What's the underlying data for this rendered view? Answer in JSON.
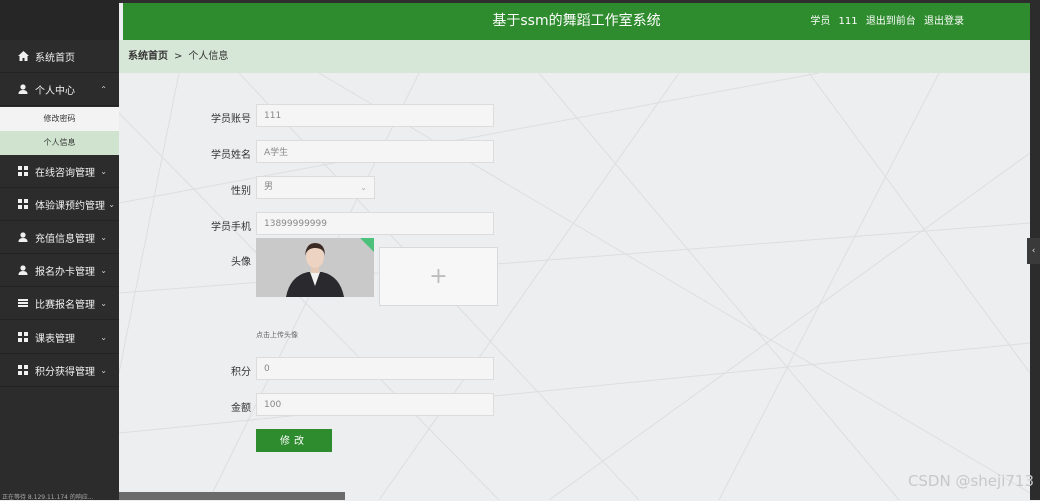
{
  "header": {
    "title": "基于ssm的舞蹈工作室系统",
    "user_role": "学员",
    "username": "111",
    "back_frontend": "退出到前台",
    "logout": "退出登录"
  },
  "breadcrumb": {
    "home": "系统首页",
    "separator": ">",
    "current": "个人信息"
  },
  "sidebar": {
    "items": [
      {
        "label": "系统首页",
        "icon": "home-icon"
      },
      {
        "label": "个人中心",
        "icon": "user-icon",
        "expanded": true
      },
      {
        "label": "在线咨询管理",
        "icon": "grid-icon"
      },
      {
        "label": "体验课预约管理",
        "icon": "grid-icon"
      },
      {
        "label": "充值信息管理",
        "icon": "user-icon"
      },
      {
        "label": "报名办卡管理",
        "icon": "user-icon"
      },
      {
        "label": "比赛报名管理",
        "icon": "list-icon"
      },
      {
        "label": "课表管理",
        "icon": "grid-icon"
      },
      {
        "label": "积分获得管理",
        "icon": "grid-icon"
      }
    ],
    "sub_items": [
      {
        "label": "修改密码",
        "active": false
      },
      {
        "label": "个人信息",
        "active": true
      }
    ]
  },
  "form": {
    "account_label": "学员账号",
    "account_value": "111",
    "name_label": "学员姓名",
    "name_value": "A学生",
    "gender_label": "性别",
    "gender_value": "男",
    "phone_label": "学员手机",
    "phone_value": "13899999999",
    "avatar_label": "头像",
    "upload_plus": "+",
    "upload_hint": "点击上传头像",
    "points_label": "积分",
    "points_value": "0",
    "amount_label": "金额",
    "amount_value": "100",
    "submit_label": "修改"
  },
  "status_text": "正在等待 8.129.11.174 的响应...",
  "watermark": "CSDN @sheji713",
  "colors": {
    "header_green": "#2e8b2e",
    "sidebar_dark": "#2c2c2c",
    "breadcrumb_bg": "#d7e7d7",
    "active_sub_bg": "#cfe3cf"
  }
}
